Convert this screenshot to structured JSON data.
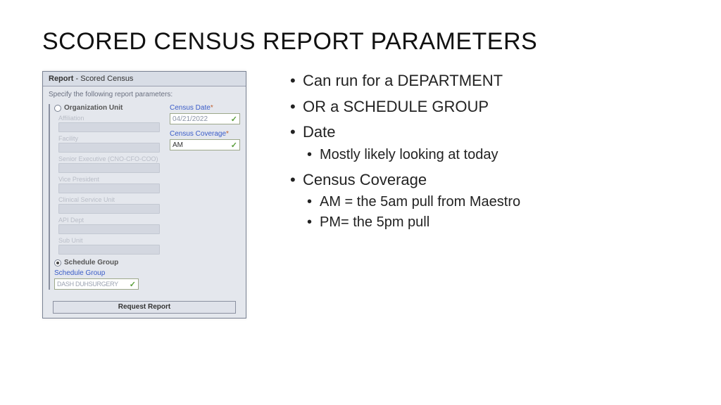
{
  "slide": {
    "title": "SCORED CENSUS REPORT PARAMETERS",
    "bullets": [
      {
        "text": "Can run for a DEPARTMENT"
      },
      {
        "text": "OR a SCHEDULE GROUP"
      },
      {
        "text": "Date",
        "sub": [
          "Mostly likely looking at today"
        ]
      },
      {
        "text": "Census Coverage",
        "sub": [
          "AM = the 5am pull from Maestro",
          "PM= the 5pm pull"
        ]
      }
    ]
  },
  "panel": {
    "header_bold": "Report",
    "header_rest": " - Scored Census",
    "instruction": "Specify the following report parameters:",
    "org_unit_label": "Organization Unit",
    "org_fields": [
      "Affiliation",
      "Facility",
      "Senior Executive (CNO-CFO-COO)",
      "Vice President",
      "Clinical Service Unit",
      "API Dept",
      "Sub Unit"
    ],
    "schedule_group_label": "Schedule Group",
    "schedule_group_field_label": "Schedule Group",
    "schedule_group_value": "DASH DUHSURGERY",
    "census_date_label": "Census Date",
    "census_date_value": "04/21/2022",
    "census_coverage_label": "Census Coverage",
    "census_coverage_value": "AM",
    "request_button": "Request Report"
  }
}
